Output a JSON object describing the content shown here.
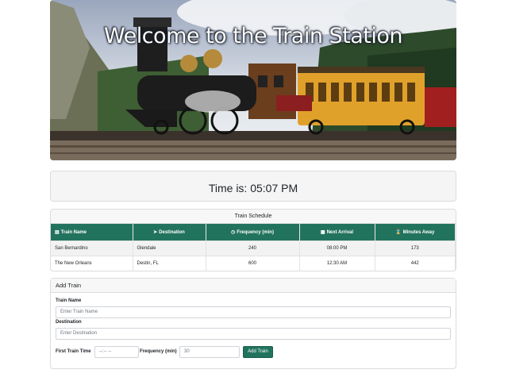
{
  "hero": {
    "title": "Welcome to the Train Station"
  },
  "clock": {
    "text": "Time is: 05:07 PM"
  },
  "schedule": {
    "title": "Train Schedule",
    "columns": [
      {
        "icon": "train-icon",
        "label": "Train Name"
      },
      {
        "icon": "paper-plane-icon",
        "label": "Destination"
      },
      {
        "icon": "clock-icon",
        "label": "Frequency (min)"
      },
      {
        "icon": "calendar-icon",
        "label": "Next Arrival"
      },
      {
        "icon": "hourglass-icon",
        "label": "Minutes Away"
      }
    ],
    "rows": [
      {
        "name": "San Bernardino",
        "destination": "Glendale",
        "frequency": "240",
        "next": "08:00 PM",
        "minutes": "173"
      },
      {
        "name": "The New Orleans",
        "destination": "Destin, FL",
        "frequency": "600",
        "next": "12:30 AM",
        "minutes": "442"
      }
    ]
  },
  "form": {
    "title": "Add Train",
    "name_label": "Train Name",
    "name_placeholder": "Enter Train Name",
    "dest_label": "Destination",
    "dest_placeholder": "Enter Destination",
    "first_label": "First Train Time",
    "first_placeholder": "--:-- --",
    "freq_label": "Frequency (min)",
    "freq_placeholder": "30",
    "submit_label": "Add Train"
  },
  "colors": {
    "accent": "#22735d"
  }
}
